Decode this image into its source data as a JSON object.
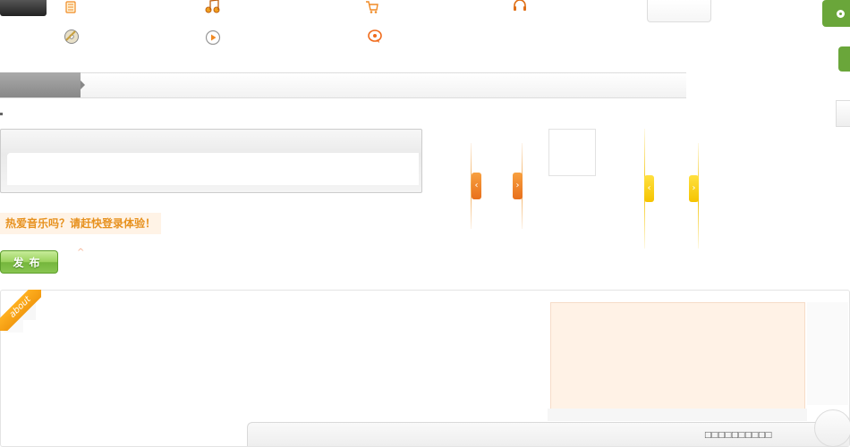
{
  "colors": {
    "accent_orange": "#f08a24",
    "accent_green": "#6aa63a",
    "login_text": "#e7911e",
    "peach_bg": "#fff2e6"
  },
  "top_nav_icons": [
    "notebook-icon",
    "music-notes-icon",
    "shopping-cart-icon",
    "headphones-icon",
    "disc-icon",
    "play-circle-icon",
    "chat-bubble-icon"
  ],
  "arrows": {
    "prev": "‹",
    "next": "›"
  },
  "login_prompt": "热爱音乐吗？请赶快登录体验！",
  "publish_button": "发布",
  "caret_mark": "^",
  "about_ribbon": "about",
  "footer_link": "□□□□□□□□□□"
}
